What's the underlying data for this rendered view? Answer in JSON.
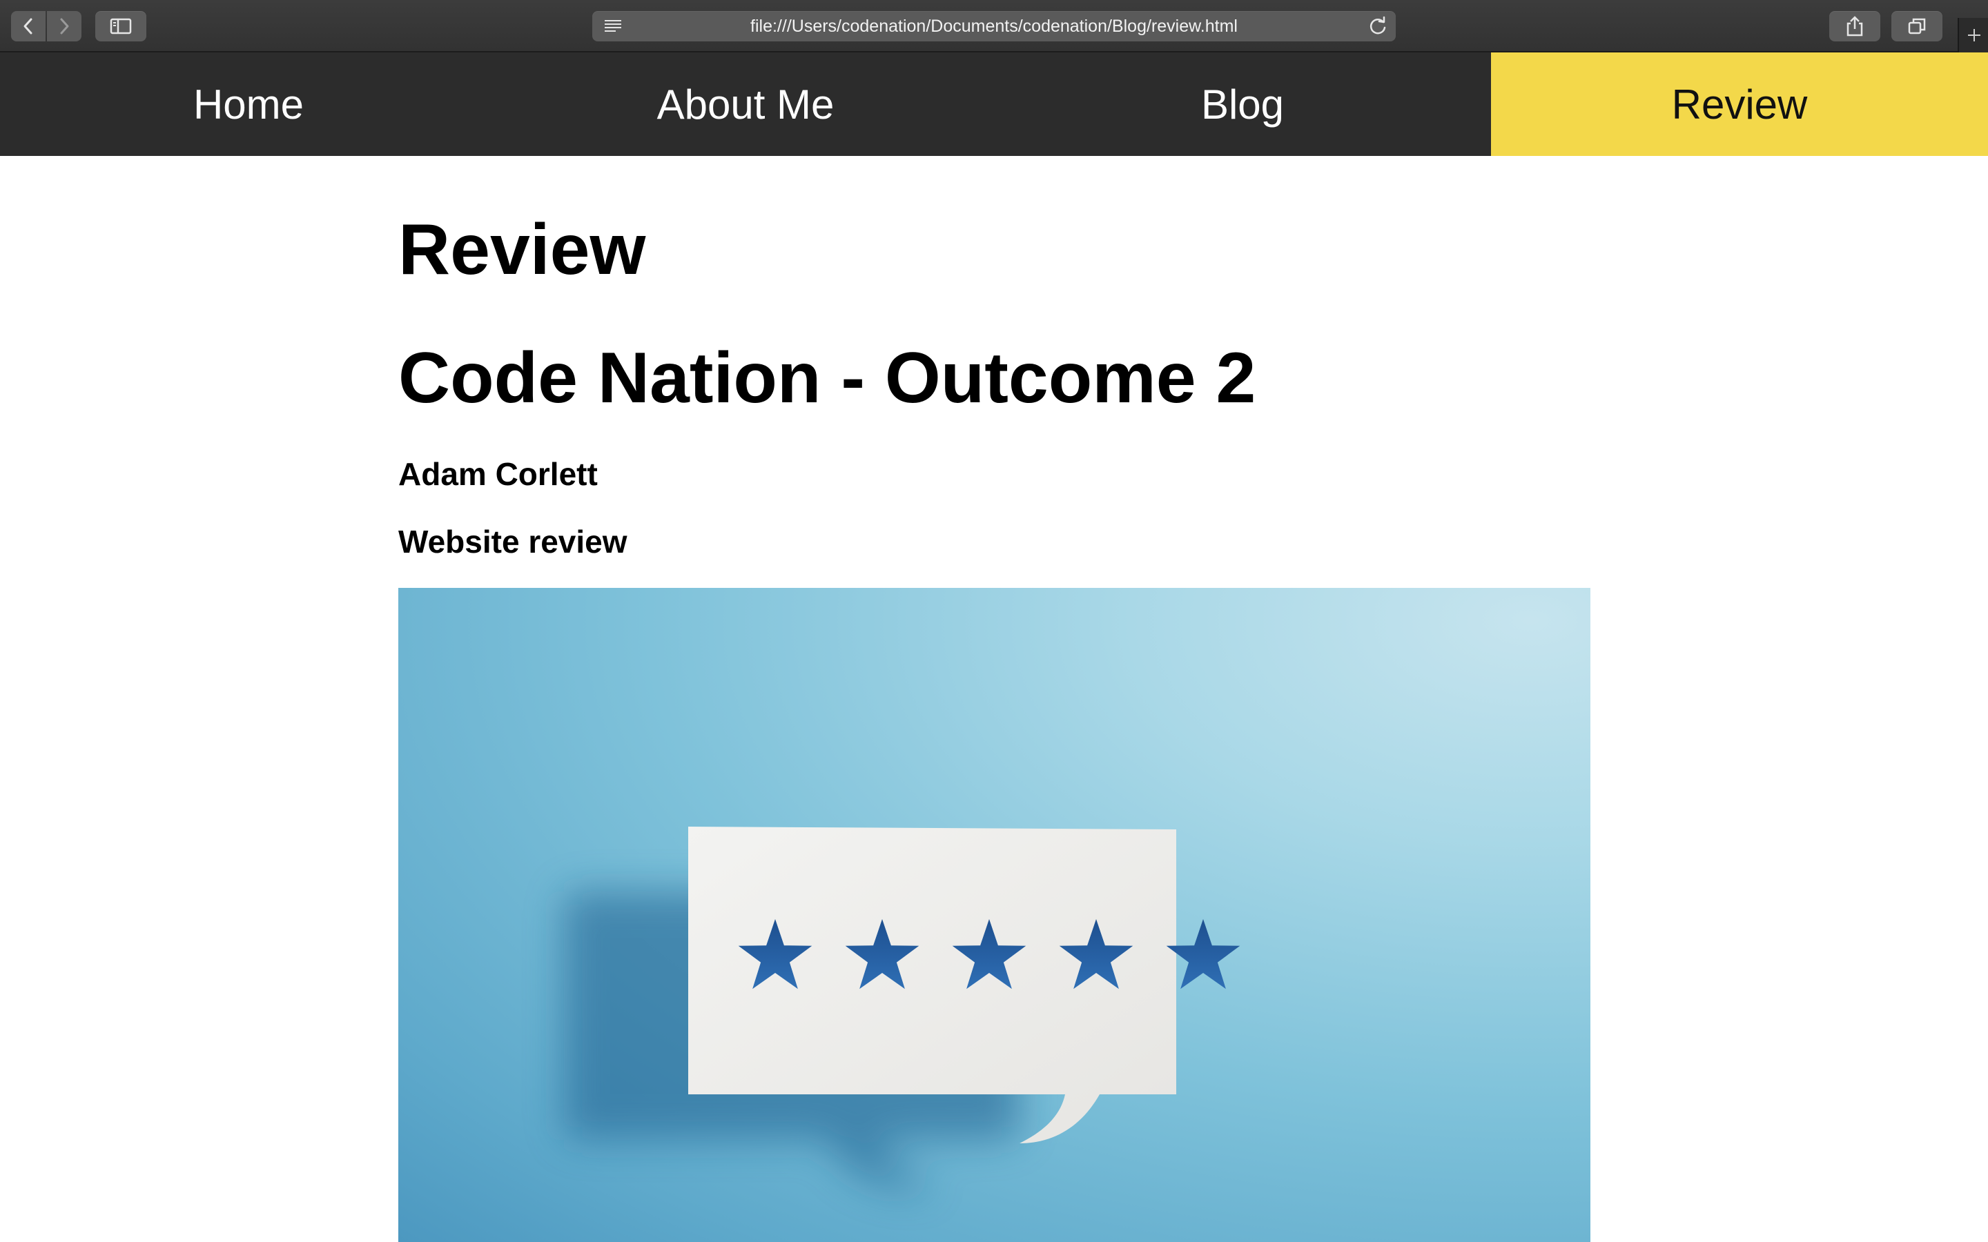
{
  "browser": {
    "url": "file:///Users/codenation/Documents/codenation/Blog/review.html"
  },
  "nav": {
    "items": [
      {
        "label": "Home"
      },
      {
        "label": "About Me"
      },
      {
        "label": "Blog"
      },
      {
        "label": "Review"
      }
    ],
    "active_index": 3,
    "bg_color": "#2c2c2c",
    "active_color": "#f3d84a"
  },
  "page": {
    "heading": "Review",
    "title": "Code Nation - Outcome 2",
    "author": "Adam Corlett",
    "subtitle": "Website review"
  },
  "hero_image": {
    "rating": 5,
    "rating_max": 5
  }
}
